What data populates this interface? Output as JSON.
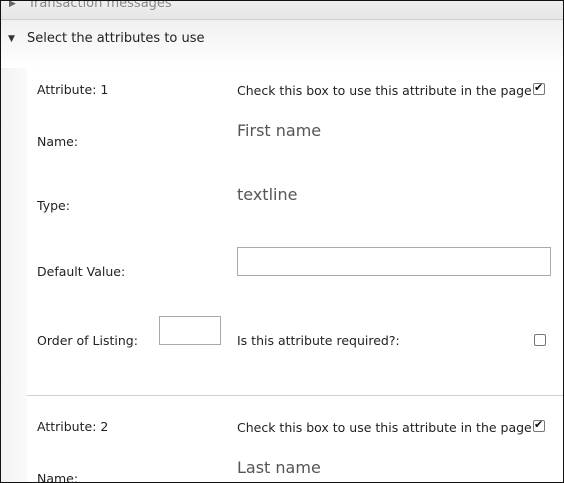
{
  "sections": {
    "transaction_messages": "Transaction messages",
    "select_attributes": "Select the attributes to use"
  },
  "icons": {
    "collapsed": "triangle-right-icon",
    "expanded": "triangle-down-icon"
  },
  "attributes": [
    {
      "header": "Attribute: 1",
      "use_label": "Check this box to use this attribute in the page",
      "use_checked": true,
      "name_label": "Name:",
      "name_value": "First name",
      "type_label": "Type:",
      "type_value": "textline",
      "default_label": "Default Value:",
      "default_value": "",
      "order_label": "Order of Listing:",
      "order_value": "",
      "required_label": "Is this attribute required?:",
      "required_checked": false
    },
    {
      "header": "Attribute: 2",
      "use_label": "Check this box to use this attribute in the page",
      "use_checked": true,
      "name_label": "Name:",
      "name_value": "Last name"
    }
  ]
}
